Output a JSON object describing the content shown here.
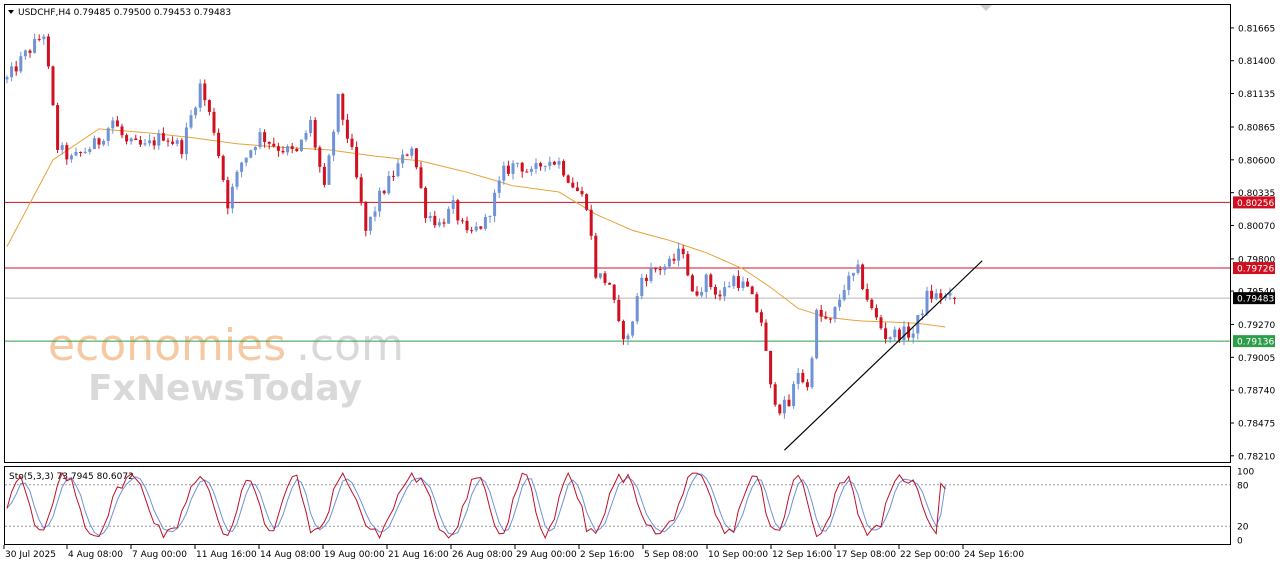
{
  "header": {
    "symbol_line": "USDCHF,H4  0.79485 0.79500 0.79453 0.79483"
  },
  "watermark": {
    "brand_orange": "economies",
    "brand_grey": ".com",
    "brand_second": "FxNewsToday"
  },
  "price_axis_ticks": [
    "0.81665",
    "0.81400",
    "0.81135",
    "0.80865",
    "0.80600",
    "0.80335",
    "0.80070",
    "0.79800",
    "0.79540",
    "0.79270",
    "0.79005",
    "0.78740",
    "0.78475",
    "0.78210"
  ],
  "price_levels": [
    {
      "label": "0.80256",
      "value": 0.80256,
      "color": "#d01020",
      "kind": "resistance"
    },
    {
      "label": "0.79726",
      "value": 0.79726,
      "color": "#d01020",
      "kind": "resistance"
    },
    {
      "label": "0.79483",
      "value": 0.79483,
      "color": "#000000",
      "kind": "current"
    },
    {
      "label": "0.79136",
      "value": 0.79136,
      "color": "#2e9e4a",
      "kind": "support"
    }
  ],
  "stochastic": {
    "label": "Sto(5,3,3) 73.7945 80.6072",
    "ticks": [
      "100",
      "80",
      "20",
      "0"
    ]
  },
  "time_axis_labels": [
    "30 Jul 2025",
    "4 Aug 08:00",
    "7 Aug 00:00",
    "11 Aug 16:00",
    "14 Aug 08:00",
    "19 Aug 00:00",
    "21 Aug 16:00",
    "26 Aug 08:00",
    "29 Aug 00:00",
    "2 Sep 16:00",
    "5 Sep 08:00",
    "10 Sep 00:00",
    "12 Sep 16:00",
    "17 Sep 08:00",
    "22 Sep 00:00",
    "24 Sep 16:00"
  ],
  "colors": {
    "bull": "#6f93d6",
    "bear": "#d01020",
    "ma": "#e8a33a",
    "stoch_main": "#c0102a",
    "stoch_signal": "#6f93d6",
    "trendline": "#000000"
  },
  "chart_data": {
    "type": "candlestick",
    "symbol": "USDCHF",
    "timeframe": "H4",
    "ohlc_last": {
      "open": 0.79485,
      "high": 0.795,
      "low": 0.79453,
      "close": 0.79483
    },
    "ylim": [
      0.7816,
      0.8185
    ],
    "close_path": [
      [
        0,
        0.8125
      ],
      [
        4,
        0.8145
      ],
      [
        8,
        0.8162
      ],
      [
        11,
        0.807
      ],
      [
        14,
        0.806
      ],
      [
        20,
        0.8075
      ],
      [
        23,
        0.8092
      ],
      [
        26,
        0.8073
      ],
      [
        30,
        0.807
      ],
      [
        34,
        0.808
      ],
      [
        38,
        0.807
      ],
      [
        42,
        0.812
      ],
      [
        45,
        0.8085
      ],
      [
        48,
        0.8025
      ],
      [
        51,
        0.8058
      ],
      [
        55,
        0.808
      ],
      [
        59,
        0.807
      ],
      [
        63,
        0.8065
      ],
      [
        66,
        0.809
      ],
      [
        69,
        0.8035
      ],
      [
        72,
        0.8108
      ],
      [
        75,
        0.8065
      ],
      [
        78,
        0.8002
      ],
      [
        81,
        0.803
      ],
      [
        85,
        0.8055
      ],
      [
        88,
        0.8072
      ],
      [
        91,
        0.8018
      ],
      [
        94,
        0.8008
      ],
      [
        97,
        0.8022
      ],
      [
        100,
        0.7998
      ],
      [
        104,
        0.801
      ],
      [
        108,
        0.805
      ],
      [
        111,
        0.8058
      ],
      [
        114,
        0.8048
      ],
      [
        117,
        0.806
      ],
      [
        120,
        0.8058
      ],
      [
        123,
        0.804
      ],
      [
        126,
        0.8025
      ],
      [
        128,
        0.7968
      ],
      [
        131,
        0.796
      ],
      [
        133,
        0.7925
      ],
      [
        135,
        0.7915
      ],
      [
        138,
        0.7965
      ],
      [
        141,
        0.7972
      ],
      [
        144,
        0.7975
      ],
      [
        147,
        0.7988
      ],
      [
        149,
        0.795
      ],
      [
        152,
        0.7963
      ],
      [
        155,
        0.795
      ],
      [
        158,
        0.7965
      ],
      [
        161,
        0.7955
      ],
      [
        164,
        0.793
      ],
      [
        166,
        0.7875
      ],
      [
        168,
        0.786
      ],
      [
        170,
        0.7862
      ],
      [
        172,
        0.789
      ],
      [
        174,
        0.7875
      ],
      [
        176,
        0.7935
      ],
      [
        179,
        0.7928
      ],
      [
        182,
        0.7958
      ],
      [
        185,
        0.797
      ],
      [
        188,
        0.7938
      ],
      [
        191,
        0.7918
      ],
      [
        194,
        0.792
      ],
      [
        197,
        0.792
      ],
      [
        200,
        0.795
      ],
      [
        203,
        0.795
      ],
      [
        205,
        0.7948
      ]
    ],
    "moving_average": [
      [
        0,
        0.799
      ],
      [
        10,
        0.806
      ],
      [
        20,
        0.8085
      ],
      [
        30,
        0.8082
      ],
      [
        40,
        0.8078
      ],
      [
        50,
        0.8073
      ],
      [
        60,
        0.807
      ],
      [
        70,
        0.8068
      ],
      [
        80,
        0.8063
      ],
      [
        90,
        0.8059
      ],
      [
        100,
        0.805
      ],
      [
        110,
        0.8039
      ],
      [
        120,
        0.8034
      ],
      [
        128,
        0.8016
      ],
      [
        136,
        0.8003
      ],
      [
        144,
        0.7995
      ],
      [
        152,
        0.7985
      ],
      [
        160,
        0.7972
      ],
      [
        166,
        0.7957
      ],
      [
        172,
        0.794
      ],
      [
        178,
        0.7933
      ],
      [
        185,
        0.793
      ],
      [
        192,
        0.7929
      ],
      [
        198,
        0.7928
      ],
      [
        204,
        0.7925
      ]
    ],
    "trendline": [
      [
        169,
        0.78255
      ],
      [
        212,
        0.79785
      ]
    ],
    "stochastic_main_last": 73.7945,
    "stochastic_signal_last": 80.6072,
    "stochastic_levels": [
      20,
      80
    ],
    "grid": false
  }
}
